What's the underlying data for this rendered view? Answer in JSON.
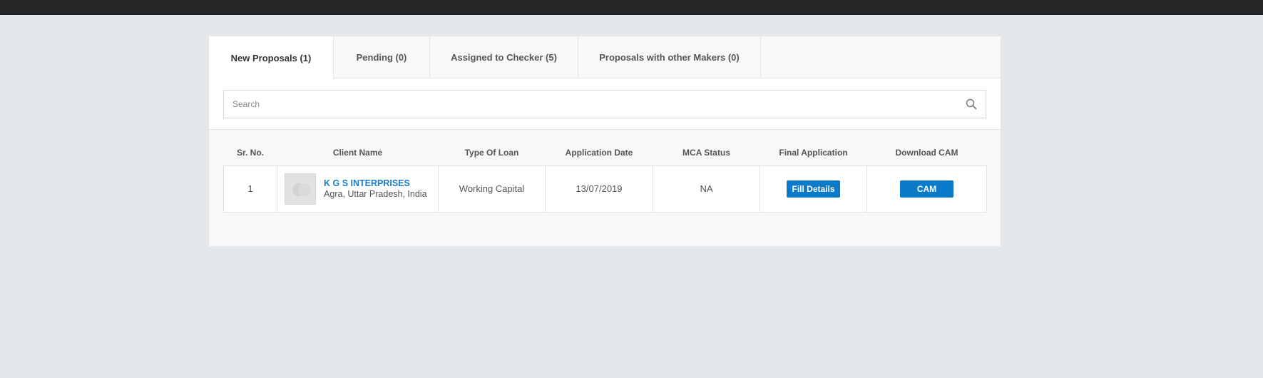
{
  "tabs": [
    {
      "label": "New Proposals (1)",
      "active": true
    },
    {
      "label": "Pending (0)",
      "active": false
    },
    {
      "label": "Assigned to Checker (5)",
      "active": false
    },
    {
      "label": "Proposals with other Makers (0)",
      "active": false
    }
  ],
  "search": {
    "placeholder": "Search",
    "value": ""
  },
  "table": {
    "headers": [
      "Sr. No.",
      "Client Name",
      "Type Of Loan",
      "Application Date",
      "MCA Status",
      "Final Application",
      "Download CAM"
    ],
    "rows": [
      {
        "sr_no": "1",
        "client_name": "K G S INTERPRISES",
        "client_location": "Agra, Uttar Pradesh, India",
        "loan_type": "Working Capital",
        "application_date": "13/07/2019",
        "mca_status": "NA",
        "final_application_label": "Fill Details",
        "download_label": "CAM"
      }
    ]
  },
  "colors": {
    "topbar": "#232527",
    "background": "#e5e8eb",
    "accent": "#0a7ac9",
    "link": "#1a7dc4"
  },
  "icons": [
    "search-icon",
    "avatar-placeholder-icon"
  ]
}
